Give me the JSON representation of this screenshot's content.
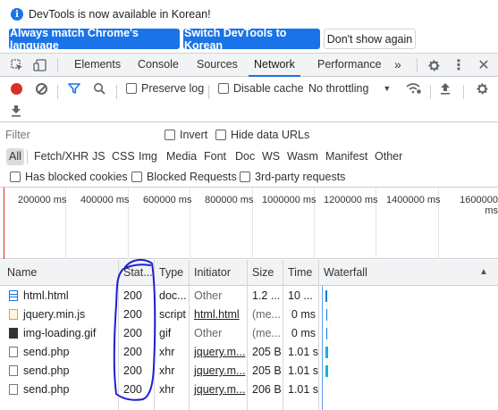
{
  "infobar": {
    "message": "DevTools is now available in Korean!",
    "btn_match": "Always match Chrome's language",
    "btn_switch": "Switch DevTools to Korean",
    "btn_dont_show": "Don't show again"
  },
  "tabs": {
    "elements": "Elements",
    "console": "Console",
    "sources": "Sources",
    "network": "Network",
    "performance": "Performance",
    "more": "»"
  },
  "toolbar": {
    "preserve_log": "Preserve log",
    "disable_cache": "Disable cache",
    "throttling": "No throttling"
  },
  "filter": {
    "placeholder": "Filter",
    "invert": "Invert",
    "hide_data_urls": "Hide data URLs"
  },
  "types": [
    "All",
    "Fetch/XHR",
    "JS",
    "CSS",
    "Img",
    "Media",
    "Font",
    "Doc",
    "WS",
    "Wasm",
    "Manifest",
    "Other"
  ],
  "block": {
    "has_blocked_cookies": "Has blocked cookies",
    "blocked_requests": "Blocked Requests",
    "third_party": "3rd-party requests"
  },
  "overview_ticks": [
    "200000 ms",
    "400000 ms",
    "600000 ms",
    "800000 ms",
    "1000000 ms",
    "1200000 ms",
    "1400000 ms",
    "1600000 ms"
  ],
  "table": {
    "headers": {
      "name": "Name",
      "status": "Stat...",
      "type": "Type",
      "initiator": "Initiator",
      "size": "Size",
      "time": "Time",
      "waterfall": "Waterfall"
    },
    "rows": [
      {
        "name": "html.html",
        "status": "200",
        "type": "doc...",
        "initiator": "Other",
        "size": "1.2 ...",
        "time": "10 ..."
      },
      {
        "name": "jquery.min.js",
        "status": "200",
        "type": "script",
        "initiator": "html.html",
        "size": "(me...",
        "time": "0 ms"
      },
      {
        "name": "img-loading.gif",
        "status": "200",
        "type": "gif",
        "initiator": "Other",
        "size": "(me...",
        "time": "0 ms"
      },
      {
        "name": "send.php",
        "status": "200",
        "type": "xhr",
        "initiator": "jquery.m...",
        "size": "205 B",
        "time": "1.01 s"
      },
      {
        "name": "send.php",
        "status": "200",
        "type": "xhr",
        "initiator": "jquery.m...",
        "size": "205 B",
        "time": "1.01 s"
      },
      {
        "name": "send.php",
        "status": "200",
        "type": "xhr",
        "initiator": "jquery.m...",
        "size": "206 B",
        "time": "1.01 s"
      }
    ]
  },
  "colors": {
    "accent": "#1a73e8",
    "record": "#d93025",
    "annotation": "#1f1fd0"
  }
}
